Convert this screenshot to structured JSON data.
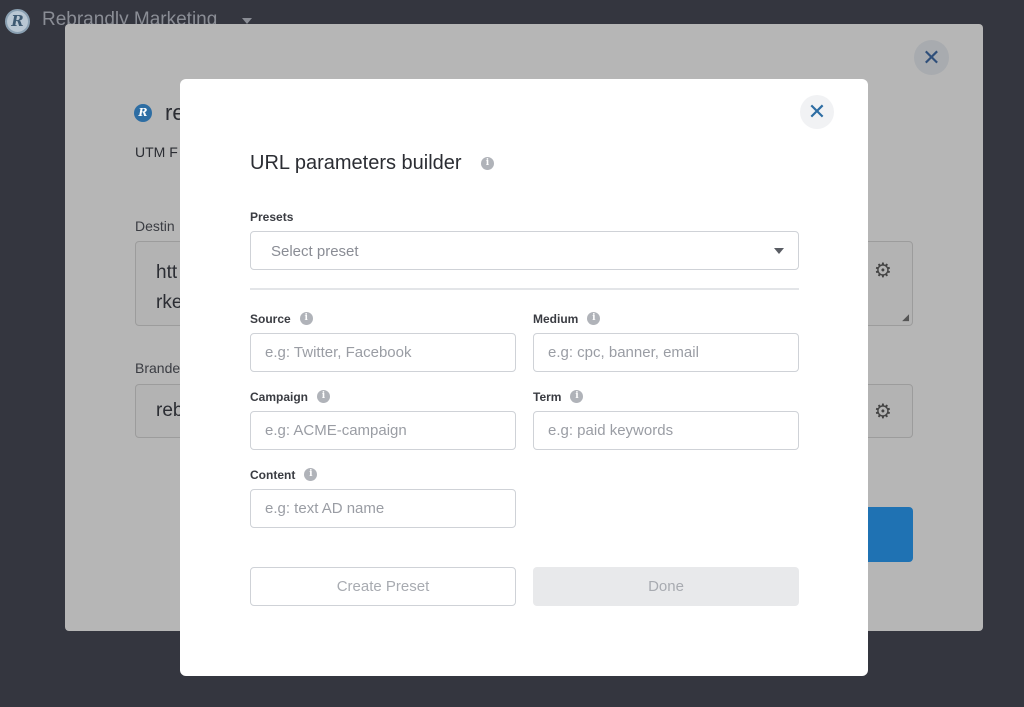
{
  "app": {
    "logo_letter": "R",
    "workspace_name": "Rebrandly Marketing"
  },
  "background_modal": {
    "close_glyph": "✕",
    "brand_icon_letter": "R",
    "title": "re",
    "subtitle": "UTM F",
    "destination_label": "Destin",
    "destination_value": "htt\nrke",
    "branded_label": "Brande",
    "branded_value": "reb",
    "gear_glyph": "⚙"
  },
  "modal": {
    "title": "URL parameters builder",
    "close_glyph": "✕",
    "info_glyph": "i",
    "presets": {
      "label": "Presets",
      "placeholder": "Select preset"
    },
    "fields": {
      "source": {
        "label": "Source",
        "placeholder": "e.g: Twitter, Facebook"
      },
      "medium": {
        "label": "Medium",
        "placeholder": "e.g: cpc, banner, email"
      },
      "campaign": {
        "label": "Campaign",
        "placeholder": "e.g: ACME-campaign"
      },
      "term": {
        "label": "Term",
        "placeholder": "e.g: paid keywords"
      },
      "content": {
        "label": "Content",
        "placeholder": "e.g: text AD name"
      }
    },
    "buttons": {
      "create_preset": "Create Preset",
      "done": "Done"
    }
  },
  "colors": {
    "backdrop": "#34363f",
    "accent": "#2d6da3",
    "primary_button": "#1f72b3"
  }
}
